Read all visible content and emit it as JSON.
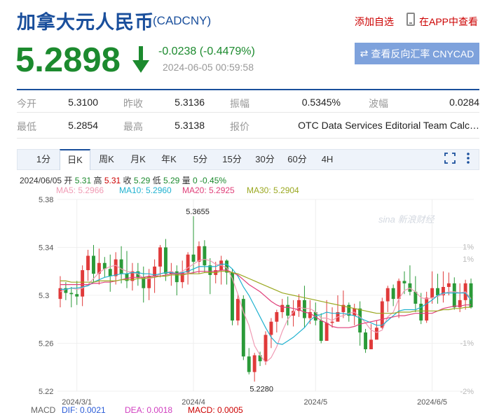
{
  "header": {
    "title": "加拿大元人民币",
    "code": "(CADCNY)",
    "add_watch": "添加自选",
    "app_link": "在APP中查看",
    "phone_icon": "phone-icon"
  },
  "quote": {
    "price": "5.2898",
    "change": "-0.0238 (-0.4479%)",
    "time": "2024-06-05 00:59:58",
    "direction_icon": "arrow-down-icon",
    "reverse_btn": "查看反向汇率 CNYCAD",
    "swap_icon": "⇄"
  },
  "stats": [
    {
      "label": "今开",
      "value": "5.3100"
    },
    {
      "label": "昨收",
      "value": "5.3136"
    },
    {
      "label": "振幅",
      "value": "0.5345%"
    },
    {
      "label": "波幅",
      "value": "0.0284"
    },
    {
      "label": "最低",
      "value": "5.2854"
    },
    {
      "label": "最高",
      "value": "5.3138"
    },
    {
      "label": "报价",
      "value": "OTC Data Services Editorial Team Calc…"
    }
  ],
  "tabs": [
    "1分",
    "日K",
    "周K",
    "月K",
    "年K",
    "5分",
    "15分",
    "30分",
    "60分",
    "4H"
  ],
  "active_tab": "日K",
  "chart_info": {
    "date": "2024/06/05",
    "open_lbl": "开",
    "open": "5.31",
    "high_lbl": "高",
    "high": "5.31",
    "close_lbl": "收",
    "close": "5.29",
    "low_lbl": "低",
    "low": "5.29",
    "vol_lbl": "量",
    "vol": "0",
    "pct": "-0.45%"
  },
  "ma_legend": [
    {
      "label": "MA5: 5.2966",
      "color": "#f09bb4"
    },
    {
      "label": "MA10: 5.2960",
      "color": "#20b2d0"
    },
    {
      "label": "MA20: 5.2925",
      "color": "#e0407a"
    },
    {
      "label": "MA30: 5.2904",
      "color": "#9aa820"
    }
  ],
  "macd_legend": [
    {
      "label": "MACD",
      "color": "#666666"
    },
    {
      "label": "DIF: 0.0021",
      "color": "#2a5cd8"
    },
    {
      "label": "DEA: 0.0018",
      "color": "#d040c0"
    },
    {
      "label": "MACD: 0.0005",
      "color": "#cc0000"
    }
  ],
  "watermark": "sina 新浪财经",
  "chart_data": {
    "type": "candlestick",
    "y_axis_labels": [
      "5.38",
      "5.34",
      "5.3",
      "5.26",
      "5.22"
    ],
    "y_axis_values": [
      5.38,
      5.34,
      5.3,
      5.26,
      5.22
    ],
    "ylim": [
      5.22,
      5.38
    ],
    "pct_axis_labels": [
      "1%",
      "1%",
      "-1%",
      "-2%"
    ],
    "pct_axis_values": [
      5.3305,
      5.3407,
      5.2602,
      5.2199
    ],
    "x_axis_labels": [
      {
        "label": "2024/3/1",
        "index": 3
      },
      {
        "label": "2024/4",
        "index": 24
      },
      {
        "label": "2024/5",
        "index": 46
      },
      {
        "label": "2024/6/5",
        "index": 67
      }
    ],
    "annotations": [
      {
        "label": "5.3655",
        "index": 24,
        "value": 5.3655
      },
      {
        "label": "5.2280",
        "index": 35,
        "value": 5.228
      }
    ],
    "up_color": "#e03a3a",
    "down_color": "#2a9a38",
    "candles": [
      [
        5.297,
        5.306,
        5.316,
        5.29
      ],
      [
        5.306,
        5.302,
        5.311,
        5.296
      ],
      [
        5.302,
        5.301,
        5.307,
        5.29
      ],
      [
        5.301,
        5.299,
        5.312,
        5.292
      ],
      [
        5.299,
        5.321,
        5.325,
        5.291
      ],
      [
        5.321,
        5.333,
        5.338,
        5.312
      ],
      [
        5.333,
        5.318,
        5.342,
        5.311
      ],
      [
        5.318,
        5.327,
        5.339,
        5.309
      ],
      [
        5.327,
        5.322,
        5.332,
        5.315
      ],
      [
        5.322,
        5.316,
        5.334,
        5.303
      ],
      [
        5.316,
        5.33,
        5.336,
        5.309
      ],
      [
        5.33,
        5.318,
        5.341,
        5.31
      ],
      [
        5.318,
        5.312,
        5.337,
        5.306
      ],
      [
        5.312,
        5.32,
        5.327,
        5.304
      ],
      [
        5.32,
        5.315,
        5.327,
        5.308
      ],
      [
        5.315,
        5.306,
        5.324,
        5.294
      ],
      [
        5.306,
        5.316,
        5.322,
        5.296
      ],
      [
        5.316,
        5.324,
        5.33,
        5.302
      ],
      [
        5.324,
        5.34,
        5.342,
        5.315
      ],
      [
        5.34,
        5.318,
        5.347,
        5.312
      ],
      [
        5.318,
        5.32,
        5.327,
        5.308
      ],
      [
        5.32,
        5.311,
        5.325,
        5.3
      ],
      [
        5.311,
        5.319,
        5.329,
        5.306
      ],
      [
        5.319,
        5.334,
        5.336,
        5.309
      ],
      [
        5.334,
        5.328,
        5.366,
        5.318
      ],
      [
        5.328,
        5.341,
        5.345,
        5.318
      ],
      [
        5.341,
        5.325,
        5.346,
        5.319
      ],
      [
        5.325,
        5.317,
        5.331,
        5.301
      ],
      [
        5.317,
        5.321,
        5.328,
        5.31
      ],
      [
        5.321,
        5.329,
        5.333,
        5.309
      ],
      [
        5.329,
        5.319,
        5.33,
        5.309
      ],
      [
        5.319,
        5.279,
        5.322,
        5.275
      ],
      [
        5.279,
        5.297,
        5.301,
        5.275
      ],
      [
        5.297,
        5.249,
        5.3,
        5.246
      ],
      [
        5.249,
        5.236,
        5.256,
        5.234
      ],
      [
        5.236,
        5.25,
        5.252,
        5.228
      ],
      [
        5.25,
        5.245,
        5.253,
        5.241
      ],
      [
        5.245,
        5.267,
        5.27,
        5.242
      ],
      [
        5.267,
        5.278,
        5.281,
        5.256
      ],
      [
        5.278,
        5.286,
        5.288,
        5.269
      ],
      [
        5.286,
        5.292,
        5.297,
        5.281
      ],
      [
        5.292,
        5.283,
        5.299,
        5.275
      ],
      [
        5.283,
        5.287,
        5.296,
        5.274
      ],
      [
        5.287,
        5.296,
        5.301,
        5.282
      ],
      [
        5.296,
        5.281,
        5.308,
        5.273
      ],
      [
        5.281,
        5.286,
        5.296,
        5.276
      ],
      [
        5.286,
        5.279,
        5.294,
        5.275
      ],
      [
        5.279,
        5.262,
        5.285,
        5.26
      ],
      [
        5.262,
        5.277,
        5.296,
        5.27
      ],
      [
        5.277,
        5.278,
        5.29,
        5.273
      ],
      [
        5.278,
        5.286,
        5.3,
        5.282
      ],
      [
        5.286,
        5.292,
        5.304,
        5.281
      ],
      [
        5.292,
        5.283,
        5.294,
        5.278
      ],
      [
        5.283,
        5.289,
        5.293,
        5.275
      ],
      [
        5.289,
        5.269,
        5.295,
        5.258
      ],
      [
        5.269,
        5.255,
        5.272,
        5.252
      ],
      [
        5.255,
        5.263,
        5.276,
        5.256
      ],
      [
        5.263,
        5.273,
        5.279,
        5.266
      ],
      [
        5.273,
        5.295,
        5.298,
        5.272
      ],
      [
        5.295,
        5.306,
        5.308,
        5.286
      ],
      [
        5.306,
        5.297,
        5.309,
        5.291
      ],
      [
        5.297,
        5.312,
        5.314,
        5.281
      ],
      [
        5.312,
        5.31,
        5.32,
        5.301
      ],
      [
        5.31,
        5.303,
        5.325,
        5.3
      ],
      [
        5.303,
        5.293,
        5.316,
        5.286
      ],
      [
        5.293,
        5.279,
        5.302,
        5.276
      ],
      [
        5.279,
        5.298,
        5.303,
        5.277
      ],
      [
        5.298,
        5.306,
        5.32,
        5.293
      ],
      [
        5.306,
        5.3,
        5.318,
        5.293
      ],
      [
        5.3,
        5.307,
        5.32,
        5.294
      ],
      [
        5.307,
        5.31,
        5.319,
        5.3
      ],
      [
        5.31,
        5.29,
        5.315,
        5.288
      ],
      [
        5.29,
        5.296,
        5.31,
        5.286
      ],
      [
        5.296,
        5.31,
        5.313,
        5.288
      ],
      [
        5.31,
        5.29,
        5.314,
        5.289
      ]
    ],
    "ma_series": [
      {
        "name": "MA5",
        "color": "#f09bb4",
        "values": [
          5.303,
          5.305,
          5.306,
          5.305,
          5.306,
          5.309,
          5.314,
          5.319,
          5.322,
          5.324,
          5.325,
          5.322,
          5.32,
          5.319,
          5.318,
          5.314,
          5.314,
          5.315,
          5.318,
          5.319,
          5.32,
          5.318,
          5.32,
          5.323,
          5.326,
          5.329,
          5.33,
          5.329,
          5.326,
          5.325,
          5.323,
          5.314,
          5.301,
          5.286,
          5.275,
          5.258,
          5.25,
          5.244,
          5.248,
          5.257,
          5.27,
          5.28,
          5.286,
          5.29,
          5.289,
          5.289,
          5.286,
          5.281,
          5.281,
          5.279,
          5.282,
          5.283,
          5.285,
          5.286,
          5.282,
          5.277,
          5.271,
          5.269,
          5.271,
          5.282,
          5.286,
          5.297,
          5.304,
          5.306,
          5.303,
          5.298,
          5.297,
          5.298,
          5.299,
          5.301,
          5.303,
          5.303,
          5.302,
          5.303,
          5.297
        ]
      },
      {
        "name": "MA10",
        "color": "#20b2d0",
        "values": [
          5.305,
          5.305,
          5.306,
          5.306,
          5.307,
          5.308,
          5.311,
          5.313,
          5.315,
          5.316,
          5.317,
          5.318,
          5.318,
          5.319,
          5.319,
          5.318,
          5.318,
          5.317,
          5.318,
          5.319,
          5.319,
          5.318,
          5.319,
          5.32,
          5.322,
          5.324,
          5.324,
          5.324,
          5.324,
          5.326,
          5.326,
          5.322,
          5.316,
          5.307,
          5.3,
          5.291,
          5.282,
          5.273,
          5.265,
          5.26,
          5.259,
          5.262,
          5.265,
          5.269,
          5.273,
          5.279,
          5.283,
          5.284,
          5.286,
          5.285,
          5.285,
          5.285,
          5.284,
          5.283,
          5.281,
          5.279,
          5.277,
          5.275,
          5.275,
          5.279,
          5.283,
          5.287,
          5.288,
          5.288,
          5.288,
          5.29,
          5.293,
          5.296,
          5.3,
          5.302,
          5.302,
          5.302,
          5.302,
          5.302,
          5.296
        ]
      },
      {
        "name": "MA20",
        "color": "#e0407a",
        "values": [
          5.309,
          5.309,
          5.309,
          5.309,
          5.309,
          5.309,
          5.31,
          5.31,
          5.311,
          5.311,
          5.312,
          5.313,
          5.314,
          5.315,
          5.315,
          5.315,
          5.316,
          5.316,
          5.316,
          5.317,
          5.318,
          5.318,
          5.318,
          5.318,
          5.319,
          5.32,
          5.32,
          5.32,
          5.32,
          5.321,
          5.321,
          5.319,
          5.317,
          5.313,
          5.309,
          5.306,
          5.303,
          5.299,
          5.295,
          5.292,
          5.29,
          5.29,
          5.289,
          5.288,
          5.286,
          5.285,
          5.282,
          5.279,
          5.277,
          5.274,
          5.273,
          5.273,
          5.273,
          5.274,
          5.276,
          5.277,
          5.278,
          5.279,
          5.28,
          5.281,
          5.282,
          5.283,
          5.283,
          5.284,
          5.285,
          5.285,
          5.285,
          5.285,
          5.287,
          5.289,
          5.29,
          5.291,
          5.291,
          5.292,
          5.292
        ]
      },
      {
        "name": "MA30",
        "color": "#9aa820",
        "values": [
          5.312,
          5.312,
          5.311,
          5.311,
          5.311,
          5.311,
          5.311,
          5.312,
          5.312,
          5.312,
          5.312,
          5.313,
          5.313,
          5.313,
          5.314,
          5.314,
          5.315,
          5.315,
          5.316,
          5.316,
          5.317,
          5.317,
          5.317,
          5.318,
          5.318,
          5.318,
          5.319,
          5.319,
          5.319,
          5.32,
          5.32,
          5.319,
          5.318,
          5.316,
          5.314,
          5.312,
          5.31,
          5.308,
          5.306,
          5.304,
          5.302,
          5.301,
          5.3,
          5.299,
          5.298,
          5.297,
          5.296,
          5.295,
          5.294,
          5.293,
          5.292,
          5.291,
          5.29,
          5.289,
          5.288,
          5.287,
          5.286,
          5.285,
          5.285,
          5.285,
          5.285,
          5.286,
          5.286,
          5.286,
          5.287,
          5.287,
          5.287,
          5.287,
          5.287,
          5.288,
          5.288,
          5.289,
          5.289,
          5.29,
          5.29
        ]
      }
    ]
  }
}
